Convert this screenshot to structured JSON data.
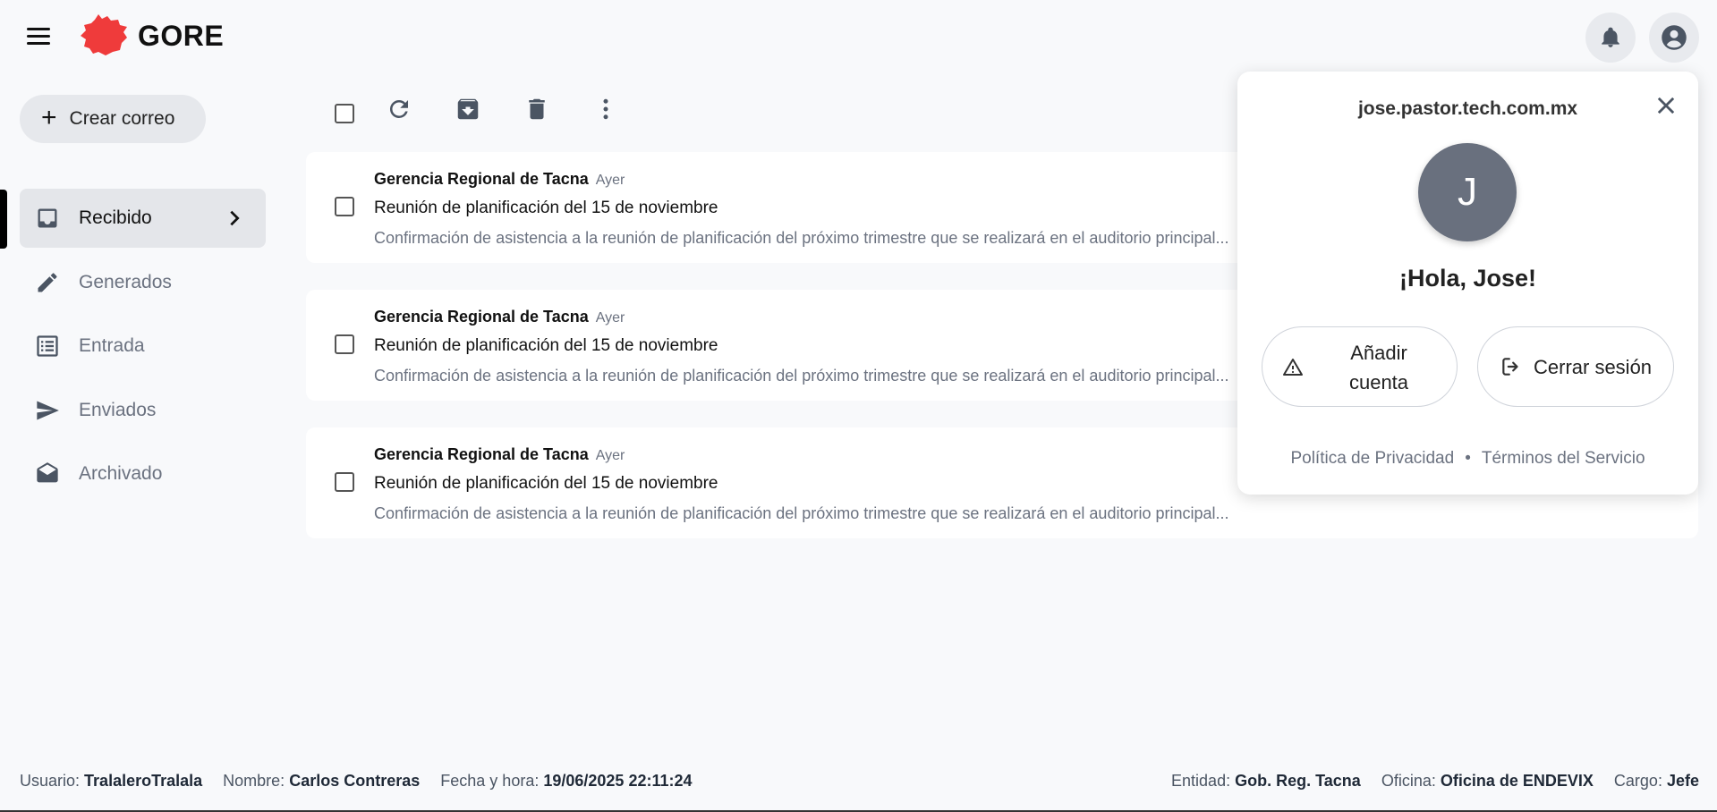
{
  "header": {
    "brand": "GORE"
  },
  "sidebar": {
    "compose_label": "Crear correo",
    "items": [
      {
        "label": "Recibido",
        "icon": "inbox-icon",
        "active": true
      },
      {
        "label": "Generados",
        "icon": "pencil-icon"
      },
      {
        "label": "Entrada",
        "icon": "list-icon"
      },
      {
        "label": "Enviados",
        "icon": "send-icon"
      },
      {
        "label": "Archivado",
        "icon": "open-envelope-icon"
      }
    ]
  },
  "mails": [
    {
      "sender": "Gerencia Regional de Tacna",
      "time": "Ayer",
      "subject": "Reunión de planificación del 15 de noviembre",
      "preview": "Confirmación de asistencia a la reunión de planificación del próximo trimestre que se realizará en el auditorio principal..."
    },
    {
      "sender": "Gerencia Regional de Tacna",
      "time": "Ayer",
      "subject": "Reunión de planificación del 15 de noviembre",
      "preview": "Confirmación de asistencia a la reunión de planificación del próximo trimestre que se realizará en el auditorio principal..."
    },
    {
      "sender": "Gerencia Regional de Tacna",
      "time": "Ayer",
      "subject": "Reunión de planificación del 15 de noviembre",
      "preview": "Confirmación de asistencia a la reunión de planificación del próximo trimestre que se realizará en el auditorio principal..."
    }
  ],
  "account_popup": {
    "email": "jose.pastor.tech.com.mx",
    "avatar_initial": "J",
    "greeting": "¡Hola, Jose!",
    "add_account_label_line1": "Añadir",
    "add_account_label_line2": "cuenta",
    "logout_label": "Cerrar sesión",
    "privacy_label": "Política de Privacidad",
    "separator": "•",
    "terms_label": "Términos del Servicio"
  },
  "footer": {
    "user_label": "Usuario:",
    "user_value": "TralaleroTralala",
    "name_label": "Nombre:",
    "name_value": "Carlos Contreras",
    "datetime_label": "Fecha y hora:",
    "datetime_value": "19/06/2025 22:11:24",
    "entity_label": "Entidad:",
    "entity_value": "Gob. Reg. Tacna",
    "office_label": "Oficina:",
    "office_value": "Oficina de ENDEVIX",
    "role_label": "Cargo:",
    "role_value": "Jefe"
  },
  "colors": {
    "brand_red": "#ef3b3b",
    "active_bg": "#e4e6ea",
    "avatar_bg": "#69707e"
  }
}
